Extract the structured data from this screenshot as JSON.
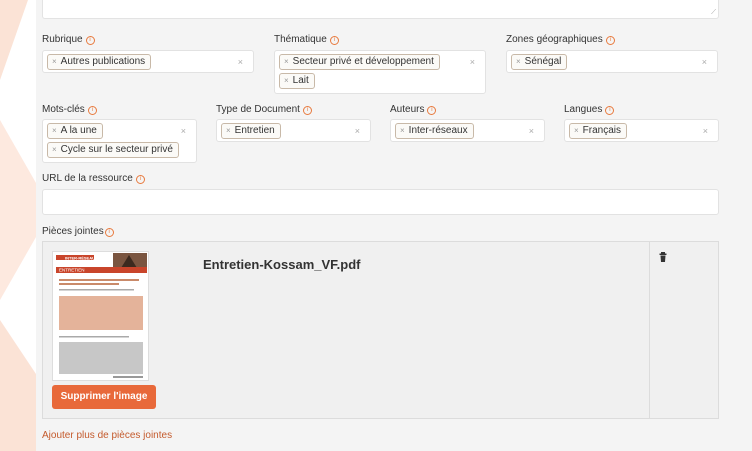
{
  "fields": {
    "rubrique": {
      "label": "Rubrique",
      "tags": [
        "Autres publications"
      ]
    },
    "thematique": {
      "label": "Thématique",
      "tags": [
        "Secteur privé et développement",
        "Lait"
      ]
    },
    "zones": {
      "label": "Zones géographiques",
      "tags": [
        "Sénégal"
      ]
    },
    "mots_cles": {
      "label": "Mots-clés",
      "tags": [
        "A la une",
        "Cycle sur le secteur privé"
      ]
    },
    "type_doc": {
      "label": "Type de Document",
      "tags": [
        "Entretien"
      ]
    },
    "auteurs": {
      "label": "Auteurs",
      "tags": [
        "Inter-réseaux"
      ]
    },
    "langues": {
      "label": "Langues",
      "tags": [
        "Français"
      ]
    },
    "url": {
      "label": "URL de la ressource",
      "value": ""
    }
  },
  "attachments": {
    "label": "Pièces jointes",
    "filename": "Entretien-Kossam_VF.pdf",
    "delete_image_label": "Supprimer l'image",
    "add_more_label": "Ajouter plus de pièces jointes",
    "thumb_logo": "INTER-RÉSEAUX",
    "thumb_header": "ENTRETIEN"
  },
  "icons": {
    "tag_remove": "×",
    "clear": "×",
    "info": "i",
    "trash": "trash-icon"
  },
  "colors": {
    "accent": "#e8693a",
    "link": "#c45a2c",
    "info": "#e87a3e"
  }
}
